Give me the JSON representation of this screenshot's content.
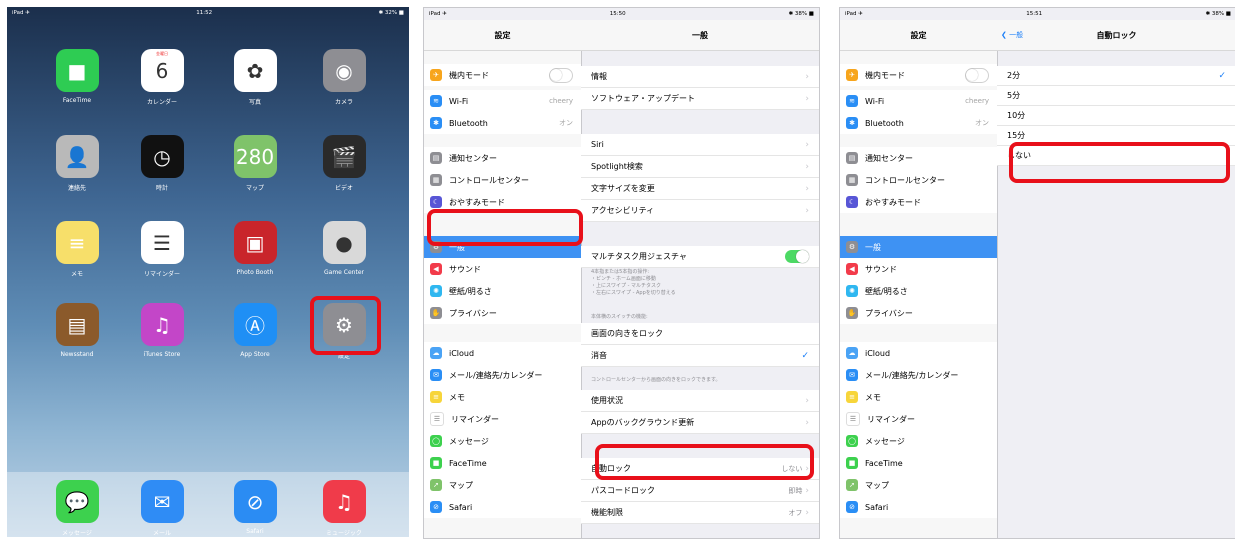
{
  "home": {
    "status": {
      "left": "iPad ✈",
      "time": "11:52",
      "right": "✱ 32% ■"
    },
    "apps": [
      {
        "label": "FaceTime",
        "color": "#2ecc53",
        "glyph": "■"
      },
      {
        "label": "カレンダー",
        "color": "#ffffff",
        "glyph": "6",
        "sub": "金曜日"
      },
      {
        "label": "写真",
        "color": "#ffffff",
        "glyph": "✿"
      },
      {
        "label": "カメラ",
        "color": "#8e8e93",
        "glyph": "◉"
      },
      {
        "label": "連絡先",
        "color": "#b9b9b9",
        "glyph": "👤"
      },
      {
        "label": "時計",
        "color": "#111111",
        "glyph": "◷"
      },
      {
        "label": "マップ",
        "color": "#7fc36a",
        "glyph": "280"
      },
      {
        "label": "ビデオ",
        "color": "#2a2a2a",
        "glyph": "🎬"
      },
      {
        "label": "メモ",
        "color": "#f7df6a",
        "glyph": "≡"
      },
      {
        "label": "リマインダー",
        "color": "#ffffff",
        "glyph": "☰"
      },
      {
        "label": "Photo Booth",
        "color": "#c9252b",
        "glyph": "▣"
      },
      {
        "label": "Game Center",
        "color": "#d9d9d9",
        "glyph": "●"
      },
      {
        "label": "Newsstand",
        "color": "#8b5a2b",
        "glyph": "▤"
      },
      {
        "label": "iTunes Store",
        "color": "#c346c8",
        "glyph": "♫"
      },
      {
        "label": "App Store",
        "color": "#1f8ff5",
        "glyph": "Ⓐ"
      },
      {
        "label": "設定",
        "color": "#8e8e93",
        "glyph": "⚙"
      }
    ],
    "dock": [
      {
        "label": "メッセージ",
        "color": "#3dd14e",
        "glyph": "💬"
      },
      {
        "label": "メール",
        "color": "#2f8cf5",
        "glyph": "✉"
      },
      {
        "label": "Safari",
        "color": "#2b8cf3",
        "glyph": "⊘"
      },
      {
        "label": "ミュージック",
        "color": "#f03b4a",
        "glyph": "♫"
      }
    ]
  },
  "sidebar": {
    "title": "設定",
    "items": [
      {
        "label": "機内モード",
        "color": "#f7a51c",
        "glyph": "✈",
        "toggle": true
      },
      {
        "label": "Wi-Fi",
        "color": "#2a8ef5",
        "glyph": "≋",
        "value": "cheery"
      },
      {
        "label": "Bluetooth",
        "color": "#2a8ef5",
        "glyph": "✱",
        "value": "オン"
      },
      {
        "label": "通知センター",
        "color": "#8e8e93",
        "glyph": "▤"
      },
      {
        "label": "コントロールセンター",
        "color": "#8e8e93",
        "glyph": "▦"
      },
      {
        "label": "おやすみモード",
        "color": "#5856d6",
        "glyph": "☾"
      },
      {
        "label": "一般",
        "color": "#8e8e93",
        "glyph": "⚙"
      },
      {
        "label": "サウンド",
        "color": "#f23b4a",
        "glyph": "◀"
      },
      {
        "label": "壁紙/明るさ",
        "color": "#2fb7f0",
        "glyph": "✺"
      },
      {
        "label": "プライバシー",
        "color": "#8e8e93",
        "glyph": "✋"
      },
      {
        "label": "iCloud",
        "color": "#4aa3f5",
        "glyph": "☁"
      },
      {
        "label": "メール/連絡先/カレンダー",
        "color": "#2a8ef5",
        "glyph": "✉"
      },
      {
        "label": "メモ",
        "color": "#f7d53a",
        "glyph": "≡"
      },
      {
        "label": "リマインダー",
        "color": "#ffffff",
        "glyph": "☰"
      },
      {
        "label": "メッセージ",
        "color": "#3dd14e",
        "glyph": "◯"
      },
      {
        "label": "FaceTime",
        "color": "#3dd14e",
        "glyph": "■"
      },
      {
        "label": "マップ",
        "color": "#7fc36a",
        "glyph": "➚"
      },
      {
        "label": "Safari",
        "color": "#2a8ef5",
        "glyph": "⊘"
      }
    ]
  },
  "general": {
    "status": {
      "left": "iPad ✈",
      "time": "15:50",
      "right": "✱ 38% ■"
    },
    "title": "一般",
    "rows": [
      {
        "label": "情報"
      },
      {
        "label": "ソフトウェア・アップデート"
      },
      {
        "label": "Siri"
      },
      {
        "label": "Spotlight検索"
      },
      {
        "label": "文字サイズを変更"
      },
      {
        "label": "アクセシビリティ"
      },
      {
        "label": "マルチタスク用ジェスチャ"
      },
      {
        "label": "画面の向きをロック"
      },
      {
        "label": "消音"
      },
      {
        "label": "使用状況"
      },
      {
        "label": "Appのバックグラウンド更新"
      },
      {
        "label": "自動ロック",
        "value": "しない"
      },
      {
        "label": "パスコードロック",
        "value": "即時"
      },
      {
        "label": "機能制限",
        "value": "オフ"
      }
    ],
    "notes": {
      "gesture_lines": [
        "4本指または5本指の操作:",
        "・ピンチ - ホーム画面に移動",
        "・上にスワイプ - マルチタスク",
        "・左右にスワイプ - Appを切り替える"
      ],
      "side_switch": "本体横のスイッチの機能:",
      "lock_note": "コントロールセンターから画面の向きをロックできます。"
    }
  },
  "autolock": {
    "status": {
      "left": "iPad ✈",
      "time": "15:51",
      "right": "✱ 38% ■"
    },
    "back": "一般",
    "title": "自動ロック",
    "options": [
      "2分",
      "5分",
      "10分",
      "15分",
      "しない"
    ]
  }
}
